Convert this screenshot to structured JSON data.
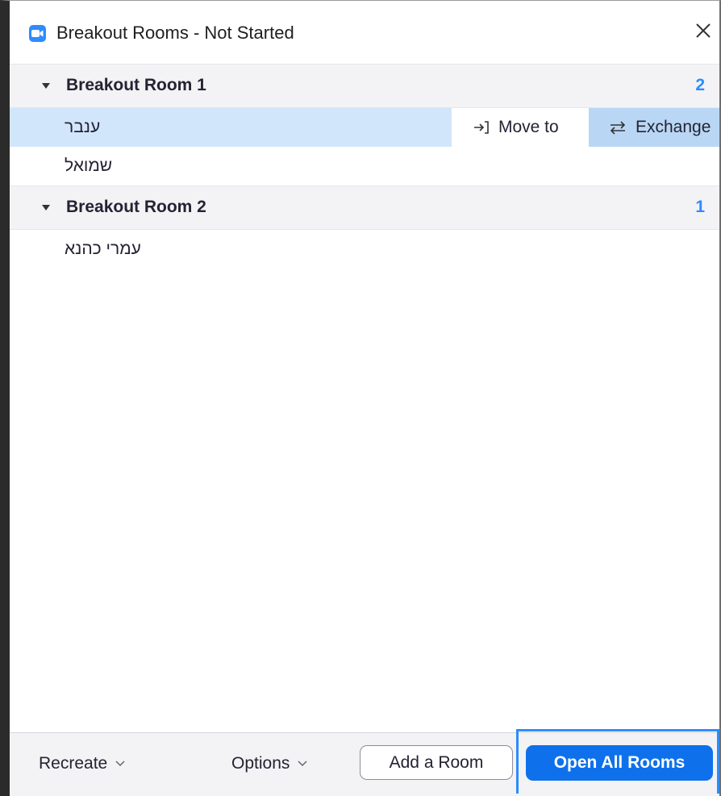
{
  "window": {
    "title": "Breakout Rooms - Not Started",
    "app_icon": "zoom-camera-icon",
    "close_icon": "close-icon"
  },
  "rooms": [
    {
      "name": "Breakout Room 1",
      "count": "2",
      "participants": [
        {
          "name": "ענבר",
          "selected": true
        },
        {
          "name": "שמואל",
          "selected": false
        }
      ]
    },
    {
      "name": "Breakout Room 2",
      "count": "1",
      "participants": [
        {
          "name": "עמרי כהנא",
          "selected": false
        }
      ]
    }
  ],
  "row_actions": {
    "move_to": "Move to",
    "exchange": "Exchange"
  },
  "footer": {
    "recreate": "Recreate",
    "options": "Options",
    "add_room": "Add a Room",
    "open_all": "Open All Rooms"
  },
  "colors": {
    "accent": "#2d8cff",
    "primary_button": "#0e71eb",
    "selected_row": "#d2e6fb",
    "exchange_hover": "#b9d7f5"
  }
}
